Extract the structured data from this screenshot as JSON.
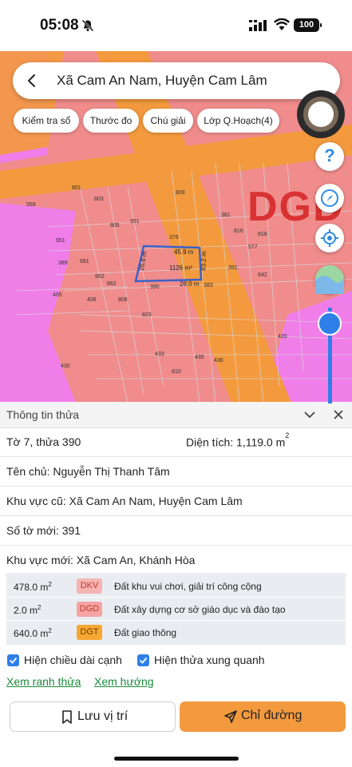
{
  "status_bar": {
    "time": "05:08",
    "battery": "100"
  },
  "search": {
    "location": "Xã Cam An Nam, Huyện Cam Lâm"
  },
  "toolbar": {
    "chips": [
      "Kiểm tra sổ",
      "Thước đo",
      "Chú giải",
      "Lớp Q.Hoạch(4)"
    ]
  },
  "fab": {
    "help": "?"
  },
  "map": {
    "zone_label": "DGD",
    "parcel_numbers": [
      "801",
      "803",
      "559",
      "351",
      "805",
      "809",
      "376",
      "381",
      "816",
      "818",
      "951",
      "389",
      "681",
      "962",
      "862",
      "390",
      "391",
      "577",
      "642",
      "405",
      "406",
      "808",
      "823",
      "420",
      "433",
      "435",
      "436",
      "430",
      "810",
      "383"
    ],
    "edge_lengths": [
      "45.9 m",
      "26.6 m",
      "83.2 m",
      "28.0 m"
    ],
    "area_label": "1126 m²",
    "colors": {
      "residential": "#f08c8c",
      "road": "#f39a3e",
      "park": "#f07ee8",
      "parcel_outline": "#3a62c8"
    }
  },
  "panel": {
    "title": "Thông tin thửa",
    "sheet_parcel": "Tờ 7, thửa 390",
    "area_label": "Diện tích: 1,119.0 m",
    "area_sup": "2",
    "owner": "Tên chủ: Nguyễn Thị Thanh Tâm",
    "old_area": "Khu vực cũ: Xã Cam An Nam, Huyện Cam Lâm",
    "new_sheet": "Số tờ mới: 391",
    "new_area": "Khu vực mới: Xã Cam An, Khánh Hòa",
    "zones": [
      {
        "area": "478.0 m",
        "sup": "2",
        "code": "DKV",
        "desc": "Đất khu vui chơi, giải trí công cộng",
        "badge_bg": "#f6b3b3"
      },
      {
        "area": "2.0 m",
        "sup": "2",
        "code": "DGD",
        "desc": "Đất xây dựng cơ sở giáo dục và đào tạo",
        "badge_bg": "#f6a3a3"
      },
      {
        "area": "640.0 m",
        "sup": "2",
        "code": "DGT",
        "desc": "Đất giao thông",
        "badge_bg": "#f7a733"
      }
    ],
    "options": {
      "show_edge_lengths": "Hiện chiều dài cạnh",
      "show_nearby": "Hiện thửa xung quanh"
    },
    "links": {
      "boundary": "Xem ranh thửa",
      "direction": "Xem hướng"
    },
    "buttons": {
      "save": "Lưu vị trí",
      "directions": "Chỉ đường"
    }
  }
}
